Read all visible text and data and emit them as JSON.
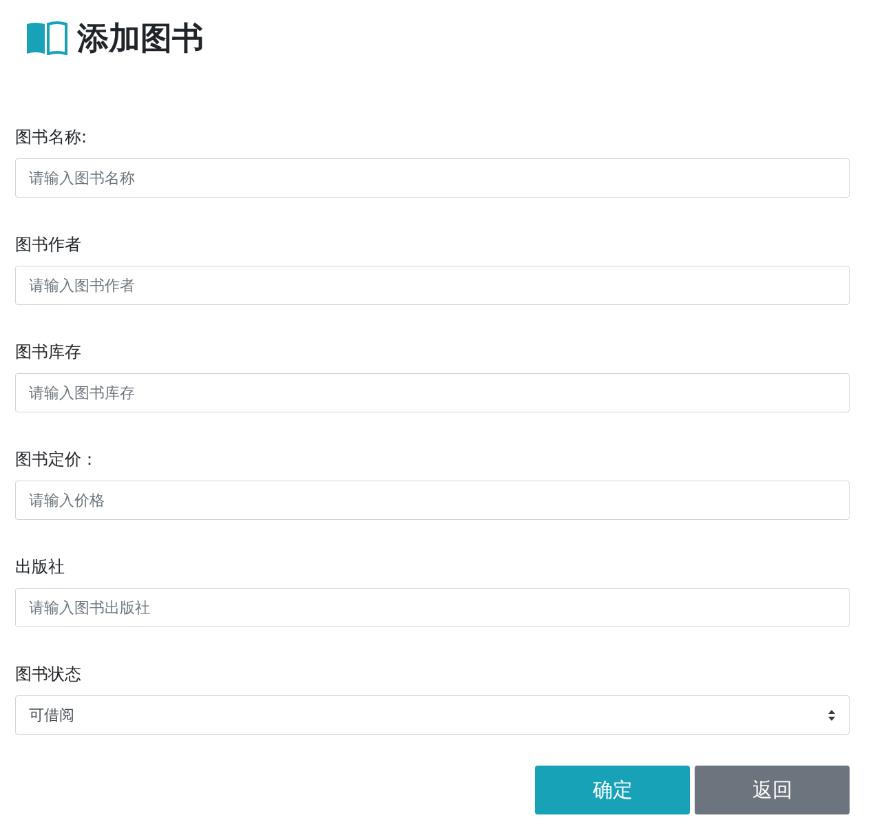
{
  "header": {
    "title": "添加图书"
  },
  "fields": [
    {
      "kind": "text",
      "label": "图书名称:",
      "placeholder": "请输入图书名称"
    },
    {
      "kind": "text",
      "label": "图书作者",
      "placeholder": "请输入图书作者"
    },
    {
      "kind": "text",
      "label": "图书库存",
      "placeholder": "请输入图书库存"
    },
    {
      "kind": "text",
      "label": "图书定价：",
      "placeholder": "请输入价格"
    },
    {
      "kind": "text",
      "label": "出版社",
      "placeholder": "请输入图书出版社"
    },
    {
      "kind": "select",
      "label": "图书状态",
      "value": "可借阅"
    }
  ],
  "buttons": [
    {
      "kind": "primary",
      "label": "确定"
    },
    {
      "kind": "secondary",
      "label": "返回"
    }
  ]
}
